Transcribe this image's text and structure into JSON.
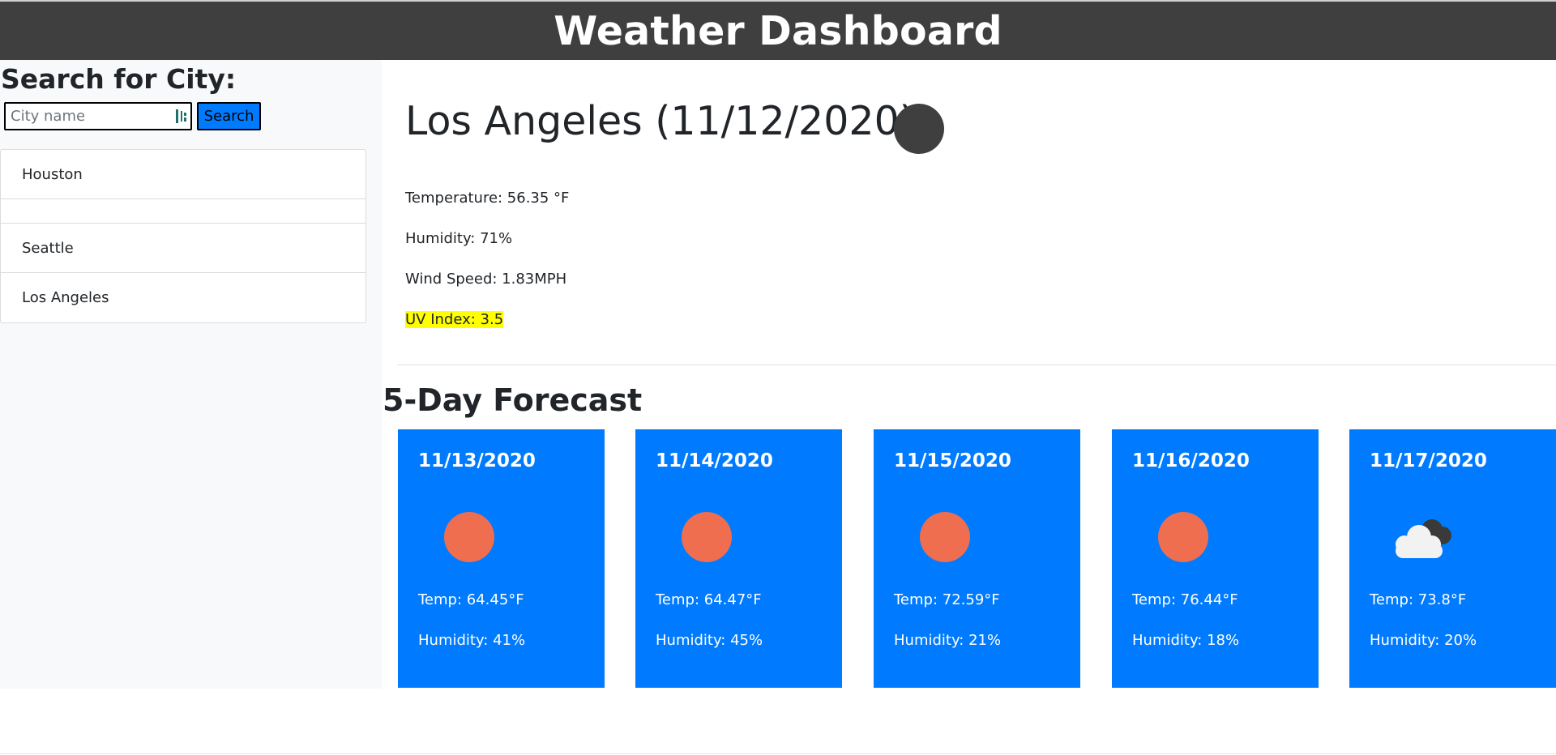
{
  "header": {
    "title": "Weather Dashboard"
  },
  "sidebar": {
    "heading": "Search for City:",
    "search": {
      "placeholder": "City name",
      "value": "",
      "button_label": "Search"
    },
    "history": [
      "Houston",
      "",
      "Seattle",
      "Los Angeles"
    ]
  },
  "current": {
    "title": "Los Angeles (11/12/2020)",
    "icon": "dark-circle-icon",
    "temperature": "Temperature: 56.35 °F",
    "humidity": "Humidity: 71%",
    "wind": "Wind Speed: 1.83MPH",
    "uv": "UV Index: 3.5"
  },
  "forecast": {
    "heading": "5-Day Forecast",
    "days": [
      {
        "date": "11/13/2020",
        "icon": "sun-icon",
        "temp": "Temp: 64.45°F",
        "humidity": "Humidity: 41%"
      },
      {
        "date": "11/14/2020",
        "icon": "sun-icon",
        "temp": "Temp: 64.47°F",
        "humidity": "Humidity: 45%"
      },
      {
        "date": "11/15/2020",
        "icon": "sun-icon",
        "temp": "Temp: 72.59°F",
        "humidity": "Humidity: 21%"
      },
      {
        "date": "11/16/2020",
        "icon": "sun-icon",
        "temp": "Temp: 76.44°F",
        "humidity": "Humidity: 18%"
      },
      {
        "date": "11/17/2020",
        "icon": "cloud-icon",
        "temp": "Temp: 73.8°F",
        "humidity": "Humidity: 20%"
      }
    ]
  },
  "colors": {
    "header_bg": "#3f3f3f",
    "accent": "#007bff",
    "uv_highlight": "#ffff00",
    "sun": "#ee6e4f"
  }
}
